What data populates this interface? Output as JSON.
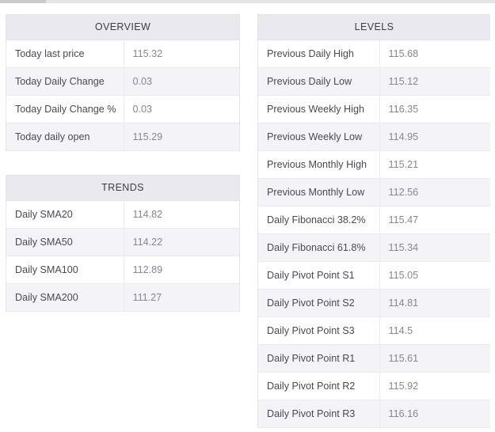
{
  "panels": {
    "overview": {
      "title": "OVERVIEW",
      "rows": [
        {
          "label": "Today last price",
          "value": "115.32"
        },
        {
          "label": "Today Daily Change",
          "value": "0.03"
        },
        {
          "label": "Today Daily Change %",
          "value": "0.03"
        },
        {
          "label": "Today daily open",
          "value": "115.29"
        }
      ]
    },
    "trends": {
      "title": "TRENDS",
      "rows": [
        {
          "label": "Daily SMA20",
          "value": "114.82"
        },
        {
          "label": "Daily SMA50",
          "value": "114.22"
        },
        {
          "label": "Daily SMA100",
          "value": "112.89"
        },
        {
          "label": "Daily SMA200",
          "value": "111.27"
        }
      ]
    },
    "levels": {
      "title": "LEVELS",
      "rows": [
        {
          "label": "Previous Daily High",
          "value": "115.68"
        },
        {
          "label": "Previous Daily Low",
          "value": "115.12"
        },
        {
          "label": "Previous Weekly High",
          "value": "116.35"
        },
        {
          "label": "Previous Weekly Low",
          "value": "114.95"
        },
        {
          "label": "Previous Monthly High",
          "value": "115.21"
        },
        {
          "label": "Previous Monthly Low",
          "value": "112.56"
        },
        {
          "label": "Daily Fibonacci 38.2%",
          "value": "115.47"
        },
        {
          "label": "Daily Fibonacci 61.8%",
          "value": "115.34"
        },
        {
          "label": "Daily Pivot Point S1",
          "value": "115.05"
        },
        {
          "label": "Daily Pivot Point S2",
          "value": "114.81"
        },
        {
          "label": "Daily Pivot Point S3",
          "value": "114.5"
        },
        {
          "label": "Daily Pivot Point R1",
          "value": "115.61"
        },
        {
          "label": "Daily Pivot Point R2",
          "value": "115.92"
        },
        {
          "label": "Daily Pivot Point R3",
          "value": "116.16"
        }
      ]
    }
  },
  "colors": {
    "header_bg": "#e9e9ef",
    "alt_row_bg": "#f4f4f8",
    "label_text": "#494952",
    "value_text": "#868692",
    "border": "#eaeaef"
  }
}
